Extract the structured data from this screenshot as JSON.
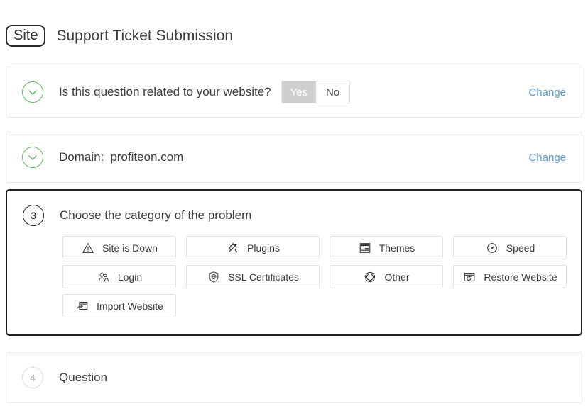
{
  "header": {
    "badge": "Site",
    "title": "Support Ticket Submission"
  },
  "colors": {
    "accent_link": "#5b9bd5",
    "done_green": "#5cb85c",
    "active_border": "#1f1f1f",
    "toggle_selected_bg": "#cfcfcf"
  },
  "steps": [
    {
      "id": "step-1",
      "state": "done",
      "icon": "check-circle-icon",
      "label": "Is this question related to your website?",
      "toggle": {
        "options": [
          "Yes",
          "No"
        ],
        "selected": "Yes"
      },
      "change_label": "Change"
    },
    {
      "id": "step-2",
      "state": "done",
      "icon": "check-circle-icon",
      "label": "Domain:",
      "value": "profiteon.com",
      "change_label": "Change"
    },
    {
      "id": "step-3",
      "state": "current",
      "number": "3",
      "label": "Choose the category of the problem",
      "categories": [
        [
          {
            "label": "Site is Down",
            "icon": "warning-triangle-icon"
          },
          {
            "label": "Plugins",
            "icon": "plug-icon"
          },
          {
            "label": "Themes",
            "icon": "layout-icon"
          },
          {
            "label": "Speed",
            "icon": "speedometer-icon"
          }
        ],
        [
          {
            "label": "Login",
            "icon": "users-icon"
          },
          {
            "label": "SSL Certificates",
            "icon": "shield-globe-icon"
          },
          {
            "label": "Other",
            "icon": "double-circle-icon"
          },
          {
            "label": "Restore Website",
            "icon": "restore-window-icon"
          }
        ],
        [
          {
            "label": "Import Website",
            "icon": "import-window-icon"
          }
        ]
      ]
    },
    {
      "id": "step-4",
      "state": "pending",
      "number": "4",
      "label": "Question"
    }
  ]
}
